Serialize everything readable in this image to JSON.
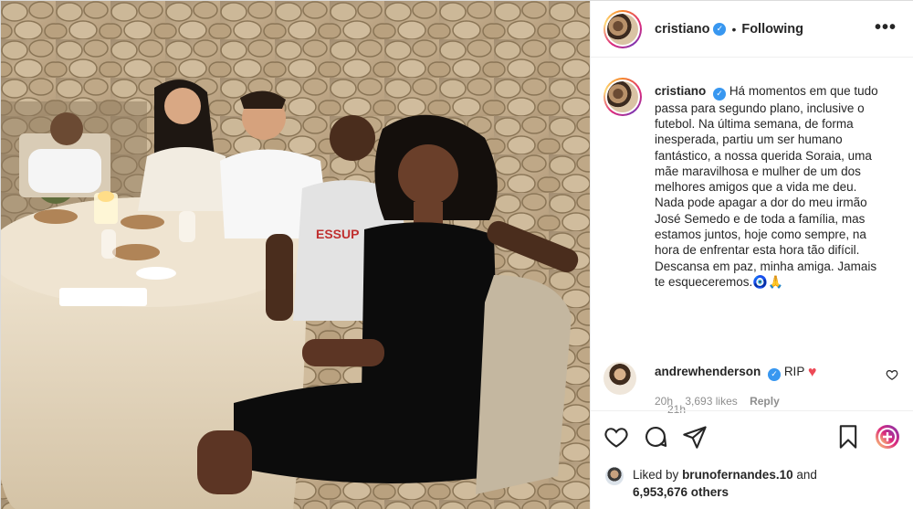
{
  "header": {
    "username": "cristiano",
    "verified_mark": "✓",
    "separator": "•",
    "follow_status": "Following",
    "more_icon": "more-horizontal-icon"
  },
  "caption": {
    "username": "cristiano",
    "verified_mark": "✓",
    "lines": [
      "Há momentos em que tudo",
      "passa para segundo plano, inclusive o",
      "futebol. Na última semana, de forma",
      "inesperada, partiu um ser humano",
      "fantástico, a nossa querida Soraia, uma",
      "mãe maravilhosa e mulher de um dos",
      "melhores amigos que a vida me deu.",
      "Nada pode apagar a dor do meu irmão",
      "José Semedo e de toda a família, mas",
      "estamos juntos, hoje como sempre, na",
      "hora de enfrentar esta hora tão difícil.",
      "Descansa em paz, minha amiga. Jamais",
      "te esqueceremos."
    ],
    "emoji": "🧿🙏",
    "time": "21h"
  },
  "comment": {
    "username": "andrewhenderson",
    "verified_mark": "✓",
    "text": "RIP",
    "heart": "♥",
    "time": "20h",
    "likes": "3,693 likes",
    "reply_label": "Reply"
  },
  "actions": {
    "icons": [
      "heart-icon",
      "comment-icon",
      "share-icon",
      "bookmark-icon",
      "story-icon"
    ]
  },
  "likes": {
    "prefix": "Liked by",
    "user": "brunofernandes.10",
    "joiner": "and",
    "count": "6,953,676 others"
  },
  "colors": {
    "text": "#262626",
    "muted": "#8e8e8e",
    "verified": "#3897f0",
    "heart": "#ed4956",
    "border": "#dbdbdb"
  }
}
